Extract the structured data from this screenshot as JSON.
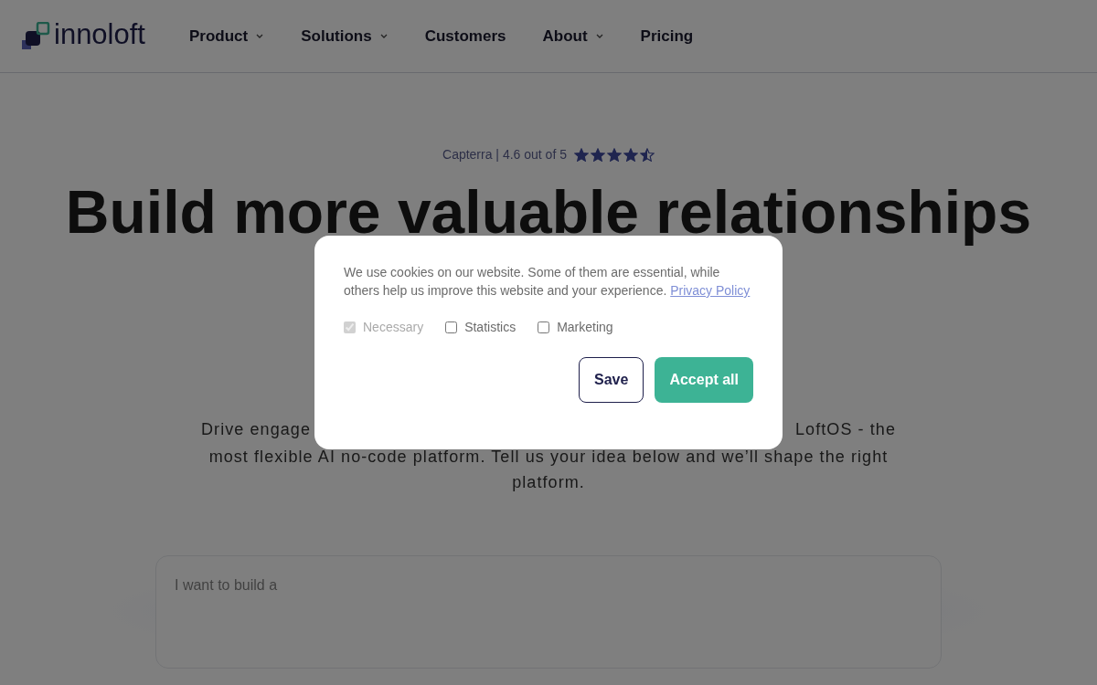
{
  "header": {
    "logo": "innoloft",
    "nav": [
      {
        "label": "Product",
        "dropdown": true
      },
      {
        "label": "Solutions",
        "dropdown": true
      },
      {
        "label": "Customers",
        "dropdown": false
      },
      {
        "label": "About",
        "dropdown": true
      },
      {
        "label": "Pricing",
        "dropdown": false
      }
    ]
  },
  "hero": {
    "rating": {
      "text": "Capterra | 4.6 out of 5",
      "stars": 4.5
    },
    "title": "Build more valuable relationships",
    "subtitle_fragments": [
      "Drive engage",
      "LoftOS - the"
    ],
    "subtitle_rest": "most flexible AI no-code platform. Tell us your idea below and we’ll shape the right platform.",
    "prompt": {
      "placeholder": "I want to build a"
    }
  },
  "cookie_dialog": {
    "text": "We use cookies on our website. Some of them are essential, while others help us improve this website and your experience.",
    "link": "Privacy Policy",
    "options": [
      {
        "label": "Necessary",
        "checked": true,
        "disabled": true
      },
      {
        "label": "Statistics",
        "checked": false,
        "disabled": false
      },
      {
        "label": "Marketing",
        "checked": false,
        "disabled": false
      }
    ],
    "buttons": [
      {
        "label": "Save",
        "kind": "outline"
      },
      {
        "label": "Accept all",
        "kind": "primary"
      }
    ]
  }
}
